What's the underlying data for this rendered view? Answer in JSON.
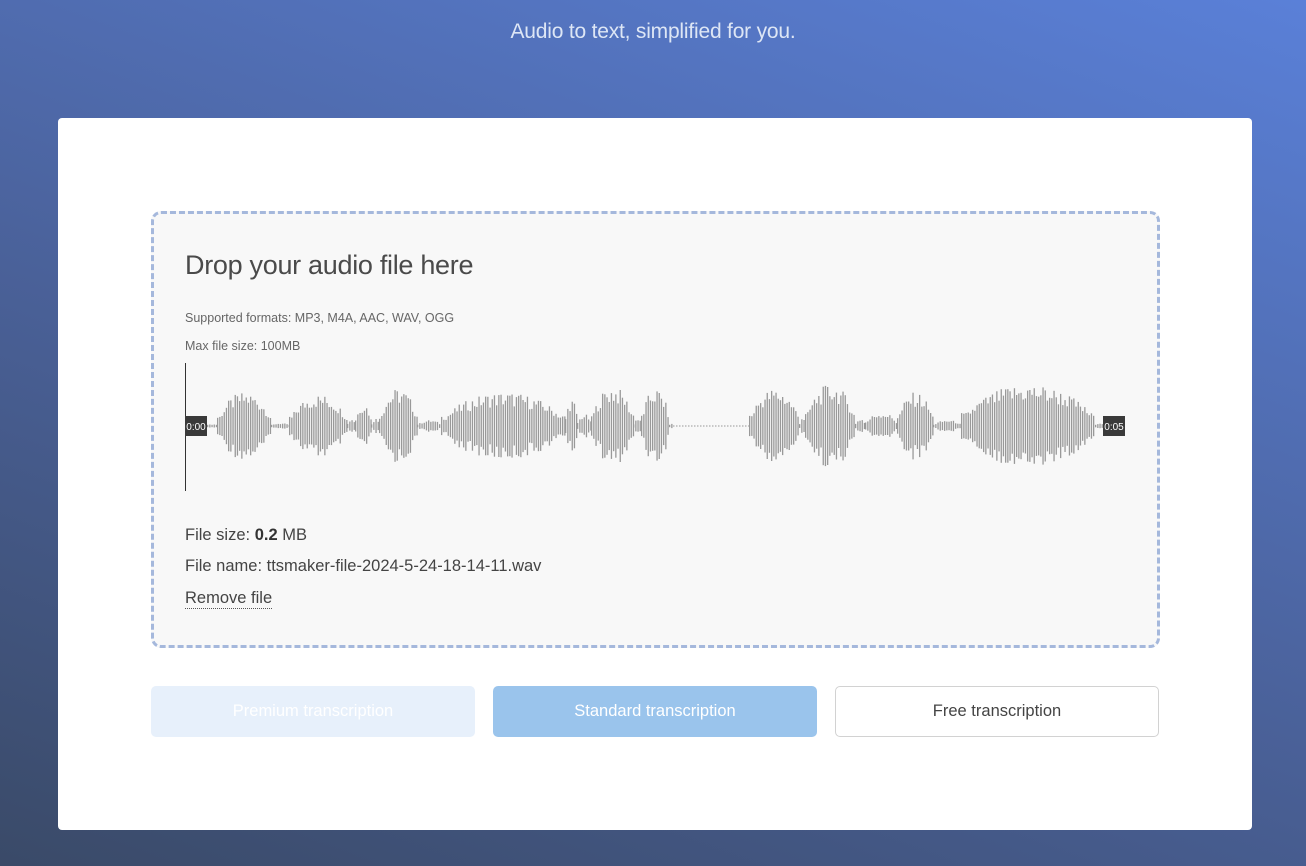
{
  "header": {
    "tagline": "Audio to text, simplified for you."
  },
  "dropzone": {
    "title": "Drop your audio file here",
    "supported_formats": "Supported formats: MP3, M4A, AAC, WAV, OGG",
    "max_file_size": "Max file size: 100MB"
  },
  "waveform": {
    "start_time": "0:00",
    "end_time": "0:05",
    "playhead_position": 0,
    "bar_color": "#999999"
  },
  "file": {
    "size_label": "File size: ",
    "size_value": "0.2",
    "size_unit": " MB",
    "name_label": "File name: ",
    "name_value": "ttsmaker-file-2024-5-24-18-14-11.wav",
    "remove_label": "Remove file"
  },
  "actions": {
    "premium_label": "Premium transcription",
    "premium_state": "disabled",
    "standard_label": "Standard transcription",
    "free_label": "Free transcription"
  },
  "colors": {
    "accent": "#9ac4ec",
    "dropzone_border": "#a5b8dc"
  }
}
